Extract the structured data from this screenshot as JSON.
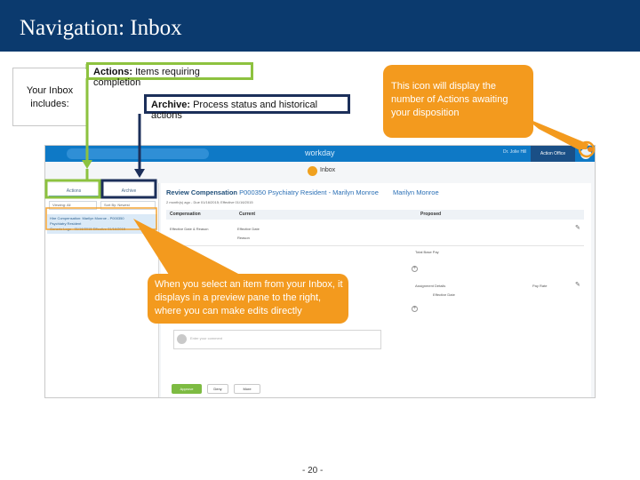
{
  "title": "Navigation: Inbox",
  "callouts": {
    "includes": "Your Inbox includes:",
    "actions_label": "Actions:",
    "actions_text": "Items requiring completion",
    "archive_label": "Archive:",
    "archive_text": "Process status and historical actions",
    "icon_note": "This icon will display the number of Actions awaiting your disposition",
    "preview_note": "When you select an item from your Inbox, it displays in a preview pane to the right, where you can make edits directly"
  },
  "screenshot": {
    "logo": "workday",
    "user": "Dr. Jolie Hill",
    "office": "Action Office",
    "inbox_title": "Inbox",
    "tabs": [
      "Actions",
      "Archive"
    ],
    "filters": [
      "Viewing: All",
      "Sort By: Newest"
    ],
    "item_lines": [
      "Hire Compensation: Marilyn Monroe - P000350",
      "Psychiatry Resident",
      "Generic Logo - 01/16/2015 Effective 01/16/2015"
    ],
    "detail_title": "Review Compensation",
    "detail_position": "P000350 Psychiatry Resident - Marilyn Monroe",
    "detail_person": "Marilyn Monroe",
    "detail_sub": "2 month(s) ago - Due 01/16/2015; Effective 01/16/2015",
    "columns": [
      "Compensation",
      "Current",
      "Proposed"
    ],
    "rows": [
      "Effective Date & Reason",
      "Effective Date",
      "Reason",
      "Total Base Pay",
      "Assignment Details",
      "Pay Rate",
      "Effective Date"
    ],
    "comment_placeholder": "Enter your comment",
    "buttons": [
      "Approve",
      "Deny",
      "More"
    ]
  },
  "page_number": "- 20 -",
  "colors": {
    "title_bar": "#0b3a6e",
    "green": "#8dc23f",
    "navy": "#1c2f5a",
    "orange": "#f39a1e",
    "workday_blue": "#0e79c6"
  }
}
